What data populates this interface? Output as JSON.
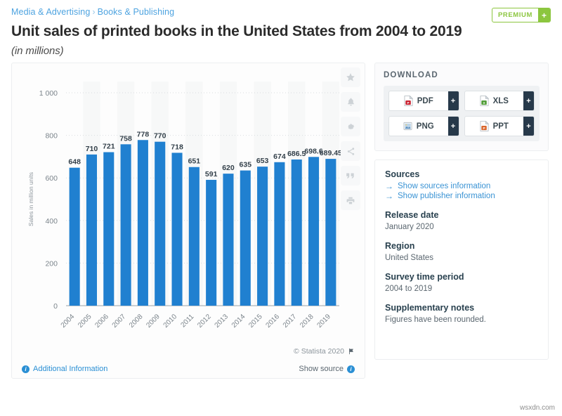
{
  "header": {
    "breadcrumb": [
      "Media & Advertising",
      "Books & Publishing"
    ],
    "breadcrumb_separator": "›",
    "title": "Unit sales of printed books in the United States from 2004 to 2019",
    "subtitle": "(in millions)",
    "premium_label": "PREMIUM",
    "premium_plus": "+"
  },
  "chart_data": {
    "type": "bar",
    "title": "Unit sales of printed books in the United States from 2004 to 2019",
    "subtitle": "(in millions)",
    "xlabel": "",
    "ylabel": "Sales in million units",
    "ylim": [
      0,
      1000
    ],
    "yticks": [
      0,
      200,
      400,
      600,
      800,
      1000
    ],
    "ytick_labels": [
      "0",
      "200",
      "400",
      "600",
      "800",
      "1 000"
    ],
    "grid": true,
    "legend": "none",
    "bar_color": "#2080d0",
    "categories": [
      "2004",
      "2005",
      "2006",
      "2007",
      "2008",
      "2009",
      "2010",
      "2011",
      "2012",
      "2013",
      "2014",
      "2015",
      "2016",
      "2017",
      "2018",
      "2019"
    ],
    "values": [
      648,
      710,
      721,
      758,
      778,
      770,
      718,
      651,
      591,
      620,
      635,
      653,
      674,
      686.5,
      698.6,
      689.45
    ],
    "value_labels": [
      "648",
      "710",
      "721",
      "758",
      "778",
      "770",
      "718",
      "651",
      "591",
      "620",
      "635",
      "653",
      "674",
      "686.5",
      "698.6",
      "689.45"
    ]
  },
  "chart_tools": [
    {
      "name": "star-icon",
      "title": "Favorite"
    },
    {
      "name": "bell-icon",
      "title": "Notify"
    },
    {
      "name": "gear-icon",
      "title": "Settings"
    },
    {
      "name": "share-icon",
      "title": "Share"
    },
    {
      "name": "quote-icon",
      "title": "Cite"
    },
    {
      "name": "print-icon",
      "title": "Print"
    }
  ],
  "chart_footer": {
    "credit": "© Statista 2020",
    "additional_information": "Additional Information",
    "show_source": "Show source"
  },
  "download": {
    "title": "DOWNLOAD",
    "plus": "+",
    "buttons": [
      {
        "label": "PDF",
        "icon": "pdf-file-icon",
        "color": "#c8202f"
      },
      {
        "label": "XLS",
        "icon": "xls-file-icon",
        "color": "#4f9c36"
      },
      {
        "label": "PNG",
        "icon": "png-file-icon",
        "color": "#5b8fbd"
      },
      {
        "label": "PPT",
        "icon": "ppt-file-icon",
        "color": "#d9652b"
      }
    ]
  },
  "sources": {
    "heading": "Sources",
    "links": [
      "Show sources information",
      "Show publisher information"
    ],
    "arrow": "→",
    "release_date_label": "Release date",
    "release_date_value": "January 2020",
    "region_label": "Region",
    "region_value": "United States",
    "survey_label": "Survey time period",
    "survey_value": "2004 to 2019",
    "notes_label": "Supplementary notes",
    "notes_value": "Figures have been rounded."
  },
  "watermark": "wsxdn.com"
}
